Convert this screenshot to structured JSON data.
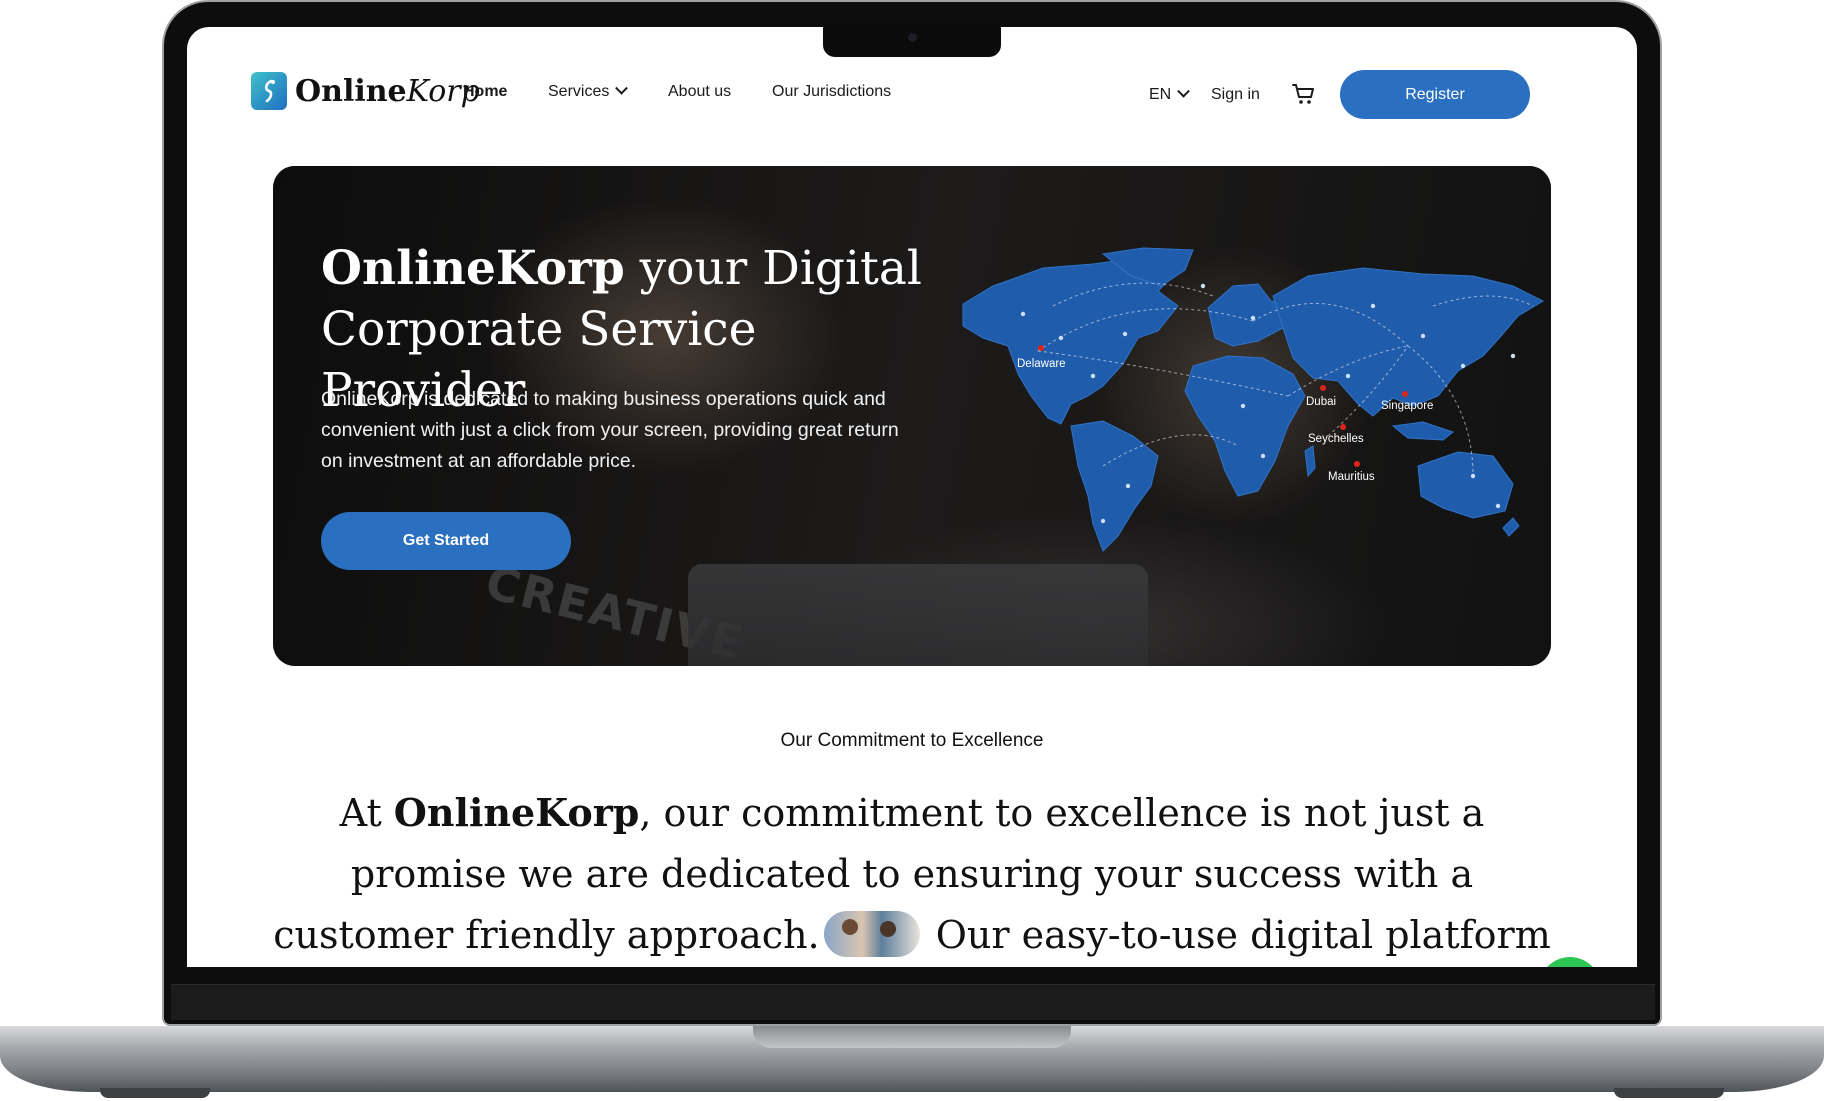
{
  "header": {
    "logo": {
      "bold": "Online",
      "italic": "Korp"
    },
    "nav": [
      {
        "label": "Home",
        "active": true
      },
      {
        "label": "Services",
        "dropdown": true
      },
      {
        "label": "About us"
      },
      {
        "label": "Our Jurisdictions"
      }
    ],
    "language": "EN",
    "sign_in": "Sign in",
    "cart_icon": "cart-icon",
    "register": "Register"
  },
  "hero": {
    "title_bold": "OnlineKorp",
    "title_rest_line1": " your Digital",
    "title_line2": "Corporate Service Provider",
    "description": "OnlineKorp is dedicated to making business operations quick and convenient with just a click from your screen, providing great return on investment at an affordable price.",
    "cta": "Get Started",
    "shirt_text": "CREATIVE",
    "map_locations": [
      "Delaware",
      "Dubai",
      "Singapore",
      "Seychelles",
      "Mauritius"
    ]
  },
  "commitment": {
    "eyebrow": "Our Commitment to Excellence",
    "text_prefix": "At ",
    "text_brand": "OnlineKorp",
    "text_part1": ", our commitment to excellence is not just a promise we are dedicated to ensuring your success with a customer friendly approach.",
    "text_part2": " Our easy-to-use digital platform simplifies"
  },
  "colors": {
    "brand_blue": "#2a6fc0",
    "map_blue": "#1f5cac",
    "marker_red": "#e0251b",
    "chat_green": "#2dc653"
  }
}
